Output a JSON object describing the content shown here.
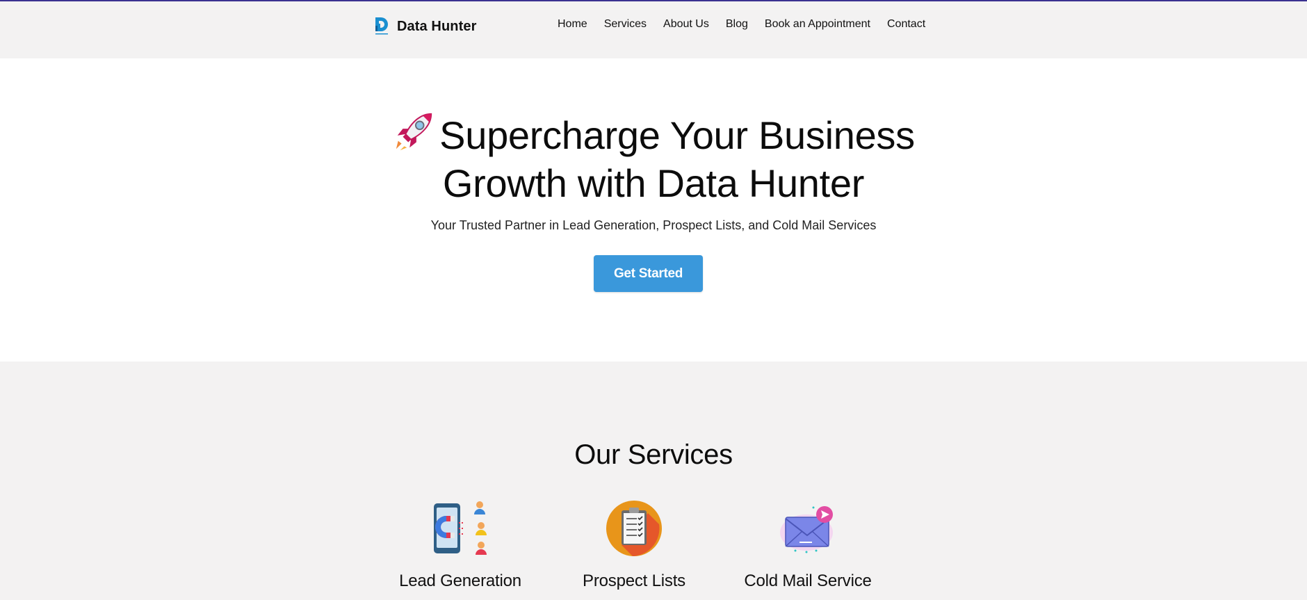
{
  "brand": {
    "name": "Data Hunter",
    "accent_color": "#1a8fd0",
    "icon": "data-hunter-logo-icon"
  },
  "nav": {
    "items": [
      {
        "label": "Home"
      },
      {
        "label": "Services"
      },
      {
        "label": "About Us"
      },
      {
        "label": "Blog"
      },
      {
        "label": "Book an Appointment"
      },
      {
        "label": "Contact"
      }
    ]
  },
  "hero": {
    "icon": "rocket-icon",
    "title_line1": "Supercharge Your Business",
    "title_line2": "Growth with Data Hunter",
    "subtitle": "Your Trusted Partner in Lead Generation, Prospect Lists, and Cold Mail Services",
    "cta_label": "Get Started",
    "cta_color": "#3a98db"
  },
  "services": {
    "title": "Our Services",
    "items": [
      {
        "label": "Lead Generation",
        "icon": "magnet-leads-icon"
      },
      {
        "label": "Prospect Lists",
        "icon": "clipboard-checklist-icon"
      },
      {
        "label": "Cold Mail Service",
        "icon": "envelope-send-icon"
      }
    ]
  },
  "colors": {
    "header_bg": "#f3f2f2",
    "top_border": "#3a3190",
    "section_bg": "#f3f2f2"
  }
}
